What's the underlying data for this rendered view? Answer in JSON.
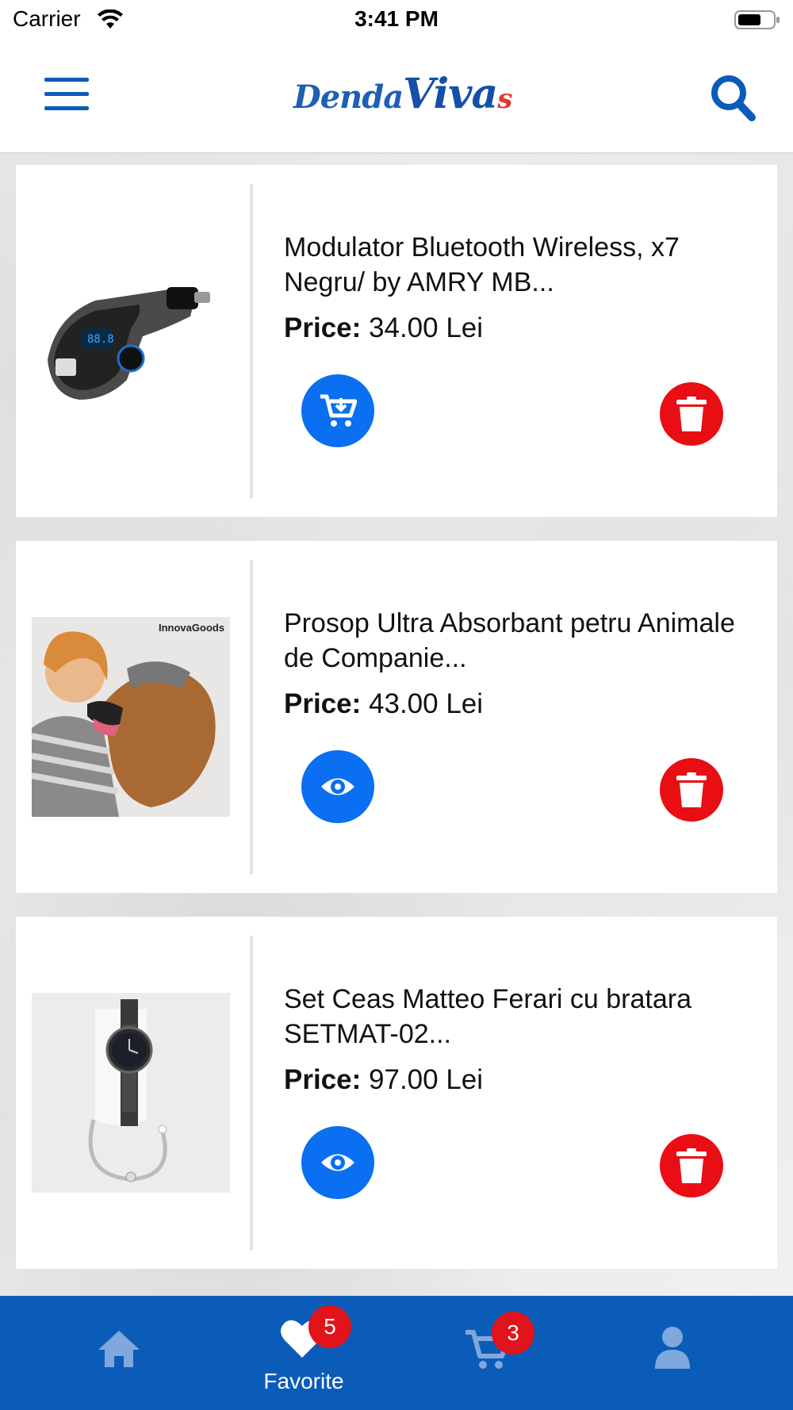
{
  "status_bar": {
    "carrier": "Carrier",
    "time": "3:41 PM"
  },
  "header": {
    "logo": {
      "part1": "Denda",
      "part2": "Viva",
      "part3": "s"
    },
    "menu_icon": "hamburger-menu-icon",
    "search_icon": "search-icon"
  },
  "favorites": [
    {
      "title": "Modulator Bluetooth Wireless, x7 Negru/ by AMRY MB...",
      "price_label": "Price:",
      "price_value": "34.00 Lei",
      "action_icon": "cart-download-icon",
      "delete_icon": "trash-icon"
    },
    {
      "title": "Prosop Ultra Absorbant petru Animale de Companie...",
      "price_label": "Price:",
      "price_value": "43.00 Lei",
      "action_icon": "eye-icon",
      "delete_icon": "trash-icon",
      "image_brand_text": "InnovaGoods"
    },
    {
      "title": "Set Ceas Matteo Ferari cu bratara SETMAT-02...",
      "price_label": "Price:",
      "price_value": "97.00 Lei",
      "action_icon": "eye-icon",
      "delete_icon": "trash-icon"
    }
  ],
  "tabbar": {
    "home_icon": "home-icon",
    "favorites": {
      "label": "Favorite",
      "badge": "5",
      "icon": "heart-icon"
    },
    "cart": {
      "badge": "3",
      "icon": "cart-icon"
    },
    "profile_icon": "user-icon"
  },
  "colors": {
    "primary_blue": "#0b5cb8",
    "button_blue": "#0a6ff0",
    "delete_red": "#e90d14",
    "badge_red": "#e1141b",
    "inactive_tab_icon": "#7fa8dc"
  }
}
